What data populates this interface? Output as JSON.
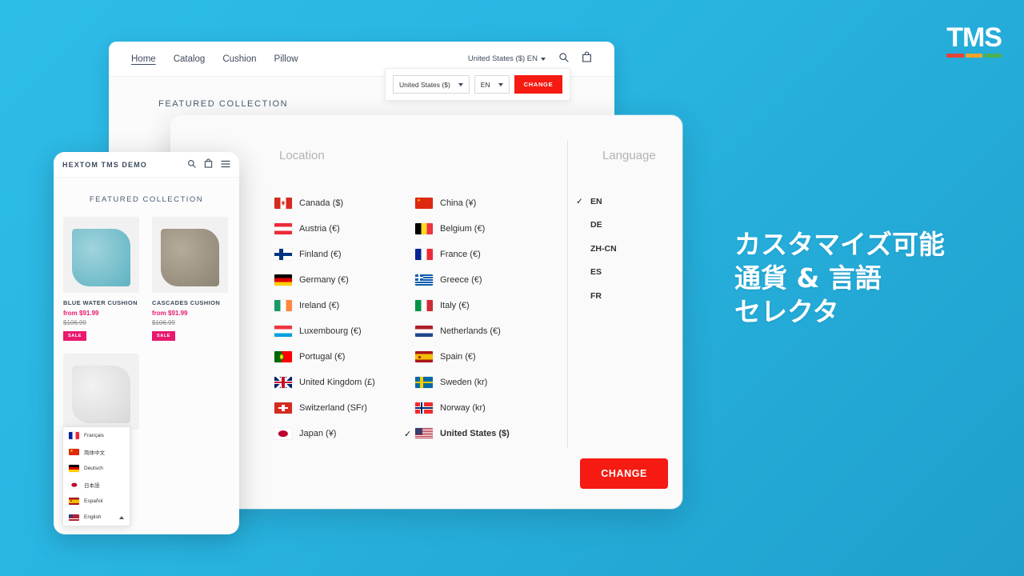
{
  "brand": {
    "logo_text": "TMS",
    "bar_colors": [
      "#E8413A",
      "#F2A32B",
      "#4CAF50"
    ]
  },
  "theme": {
    "background_from": "#2EBCE8",
    "background_to": "#1F9FCC",
    "accent_red": "#F51A12",
    "sale_pink": "#E8196E",
    "text_dark": "#3d4a5c"
  },
  "marketing": {
    "line1": "カスタマイズ可能",
    "line2": "通貨 & 言語",
    "line3": "セレクタ"
  },
  "desktop": {
    "nav_links": [
      {
        "label": "Home",
        "active": true
      },
      {
        "label": "Catalog",
        "active": false
      },
      {
        "label": "Cushion",
        "active": false
      },
      {
        "label": "Pillow",
        "active": false
      }
    ],
    "selector_label": "United States ($) EN",
    "icons": [
      "search-icon",
      "bag-icon"
    ],
    "featured_heading": "FEATURED COLLECTION",
    "inline_popup": {
      "country_value": "United States ($)",
      "language_value": "EN",
      "change_label": "CHANGE"
    }
  },
  "modal": {
    "location_title": "Location",
    "language_title": "Language",
    "change_label": "CHANGE",
    "locations_col1": [
      {
        "name": "Canada ($)",
        "flag": "ca",
        "selected": false
      },
      {
        "name": "Austria (€)",
        "flag": "at",
        "selected": false
      },
      {
        "name": "Finland (€)",
        "flag": "fi",
        "selected": false
      },
      {
        "name": "Germany (€)",
        "flag": "de",
        "selected": false
      },
      {
        "name": "Ireland (€)",
        "flag": "ie",
        "selected": false
      },
      {
        "name": "Luxembourg (€)",
        "flag": "lu",
        "selected": false
      },
      {
        "name": "Portugal (€)",
        "flag": "pt",
        "selected": false
      },
      {
        "name": "United Kingdom (£)",
        "flag": "gb",
        "selected": false
      },
      {
        "name": "Switzerland (SFr)",
        "flag": "ch",
        "selected": false
      },
      {
        "name": "Japan (¥)",
        "flag": "jp",
        "selected": false
      }
    ],
    "locations_col2": [
      {
        "name": "China (¥)",
        "flag": "cn",
        "selected": false
      },
      {
        "name": "Belgium (€)",
        "flag": "be",
        "selected": false
      },
      {
        "name": "France (€)",
        "flag": "fr",
        "selected": false
      },
      {
        "name": "Greece (€)",
        "flag": "gr",
        "selected": false
      },
      {
        "name": "Italy (€)",
        "flag": "it",
        "selected": false
      },
      {
        "name": "Netherlands (€)",
        "flag": "nl",
        "selected": false
      },
      {
        "name": "Spain (€)",
        "flag": "es",
        "selected": false
      },
      {
        "name": "Sweden (kr)",
        "flag": "se",
        "selected": false
      },
      {
        "name": "Norway (kr)",
        "flag": "no",
        "selected": false
      },
      {
        "name": "United States ($)",
        "flag": "us",
        "selected": true
      }
    ],
    "languages": [
      {
        "code": "EN",
        "selected": true
      },
      {
        "code": "DE",
        "selected": false
      },
      {
        "code": "ZH-CN",
        "selected": false
      },
      {
        "code": "ES",
        "selected": false
      },
      {
        "code": "FR",
        "selected": false
      }
    ]
  },
  "mobile": {
    "brand": "HEXTOM TMS DEMO",
    "icons": [
      "search-icon",
      "bag-icon",
      "menu-icon"
    ],
    "featured_heading": "FEATURED COLLECTION",
    "products": [
      {
        "title": "BLUE WATER CUSHION",
        "price": "from $91.99",
        "compare_at": "$106.99",
        "badge": "SALE",
        "swatch_a": "#9fd4dc",
        "swatch_b": "#5fb2c2"
      },
      {
        "title": "CASCADES CUSHION",
        "price": "from $91.99",
        "compare_at": "$106.99",
        "badge": "SALE",
        "swatch_a": "#b5ab9a",
        "swatch_b": "#8c8374"
      }
    ],
    "language_dropdown": [
      {
        "label": "Français",
        "flag": "fr",
        "selected": false
      },
      {
        "label": "简体中文",
        "flag": "cn",
        "selected": false
      },
      {
        "label": "Deutsch",
        "flag": "de",
        "selected": false
      },
      {
        "label": "日本語",
        "flag": "jp",
        "selected": false
      },
      {
        "label": "Español",
        "flag": "es",
        "selected": false
      },
      {
        "label": "English",
        "flag": "us",
        "selected": true
      }
    ]
  }
}
